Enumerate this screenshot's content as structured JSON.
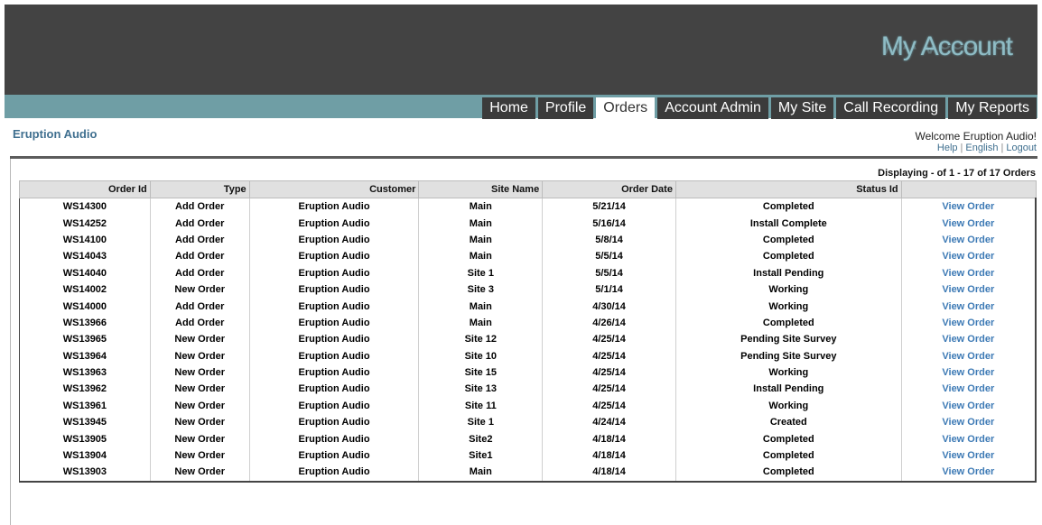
{
  "header": {
    "brand": "My Account"
  },
  "nav": {
    "tabs": [
      "Home",
      "Profile",
      "Orders",
      "Account Admin",
      "My Site",
      "Call Recording",
      "My Reports"
    ],
    "active": "Orders"
  },
  "account": {
    "company": "Eruption Audio",
    "welcome": "Welcome Eruption Audio!",
    "links": [
      "Help",
      "English",
      "Logout"
    ]
  },
  "orders": {
    "displaying": "Displaying - of 1 - 17 of 17 Orders",
    "columns": [
      "Order Id",
      "Type",
      "Customer",
      "Site Name",
      "Order Date",
      "Status Id",
      ""
    ],
    "action_label": "View Order",
    "rows": [
      {
        "id": "WS14300",
        "type": "Add Order",
        "customer": "Eruption Audio",
        "site": "Main",
        "date": "5/21/14",
        "status": "Completed"
      },
      {
        "id": "WS14252",
        "type": "Add Order",
        "customer": "Eruption Audio",
        "site": "Main",
        "date": "5/16/14",
        "status": "Install Complete"
      },
      {
        "id": "WS14100",
        "type": "Add Order",
        "customer": "Eruption Audio",
        "site": "Main",
        "date": "5/8/14",
        "status": "Completed"
      },
      {
        "id": "WS14043",
        "type": "Add Order",
        "customer": "Eruption Audio",
        "site": "Main",
        "date": "5/5/14",
        "status": "Completed"
      },
      {
        "id": "WS14040",
        "type": "Add Order",
        "customer": "Eruption Audio",
        "site": "Site 1",
        "date": "5/5/14",
        "status": "Install Pending"
      },
      {
        "id": "WS14002",
        "type": "New Order",
        "customer": "Eruption Audio",
        "site": "Site 3",
        "date": "5/1/14",
        "status": "Working"
      },
      {
        "id": "WS14000",
        "type": "Add Order",
        "customer": "Eruption Audio",
        "site": "Main",
        "date": "4/30/14",
        "status": "Working"
      },
      {
        "id": "WS13966",
        "type": "Add Order",
        "customer": "Eruption Audio",
        "site": "Main",
        "date": "4/26/14",
        "status": "Completed"
      },
      {
        "id": "WS13965",
        "type": "New Order",
        "customer": "Eruption Audio",
        "site": "Site 12",
        "date": "4/25/14",
        "status": "Pending Site Survey"
      },
      {
        "id": "WS13964",
        "type": "New Order",
        "customer": "Eruption Audio",
        "site": "Site 10",
        "date": "4/25/14",
        "status": "Pending Site Survey"
      },
      {
        "id": "WS13963",
        "type": "New Order",
        "customer": "Eruption Audio",
        "site": "Site 15",
        "date": "4/25/14",
        "status": "Working"
      },
      {
        "id": "WS13962",
        "type": "New Order",
        "customer": "Eruption Audio",
        "site": "Site 13",
        "date": "4/25/14",
        "status": "Install Pending"
      },
      {
        "id": "WS13961",
        "type": "New Order",
        "customer": "Eruption Audio",
        "site": "Site 11",
        "date": "4/25/14",
        "status": "Working"
      },
      {
        "id": "WS13945",
        "type": "New Order",
        "customer": "Eruption Audio",
        "site": "Site 1",
        "date": "4/24/14",
        "status": "Created"
      },
      {
        "id": "WS13905",
        "type": "New Order",
        "customer": "Eruption Audio",
        "site": "Site2",
        "date": "4/18/14",
        "status": "Completed"
      },
      {
        "id": "WS13904",
        "type": "New Order",
        "customer": "Eruption Audio",
        "site": "Site1",
        "date": "4/18/14",
        "status": "Completed"
      },
      {
        "id": "WS13903",
        "type": "New Order",
        "customer": "Eruption Audio",
        "site": "Main",
        "date": "4/18/14",
        "status": "Completed"
      }
    ]
  },
  "colors": {
    "header_bg": "#434343",
    "nav_bg": "#6f9ea5",
    "tab_bg": "#3b3b3b",
    "brand": "#8fbcc5",
    "link": "#3d7ab5"
  }
}
